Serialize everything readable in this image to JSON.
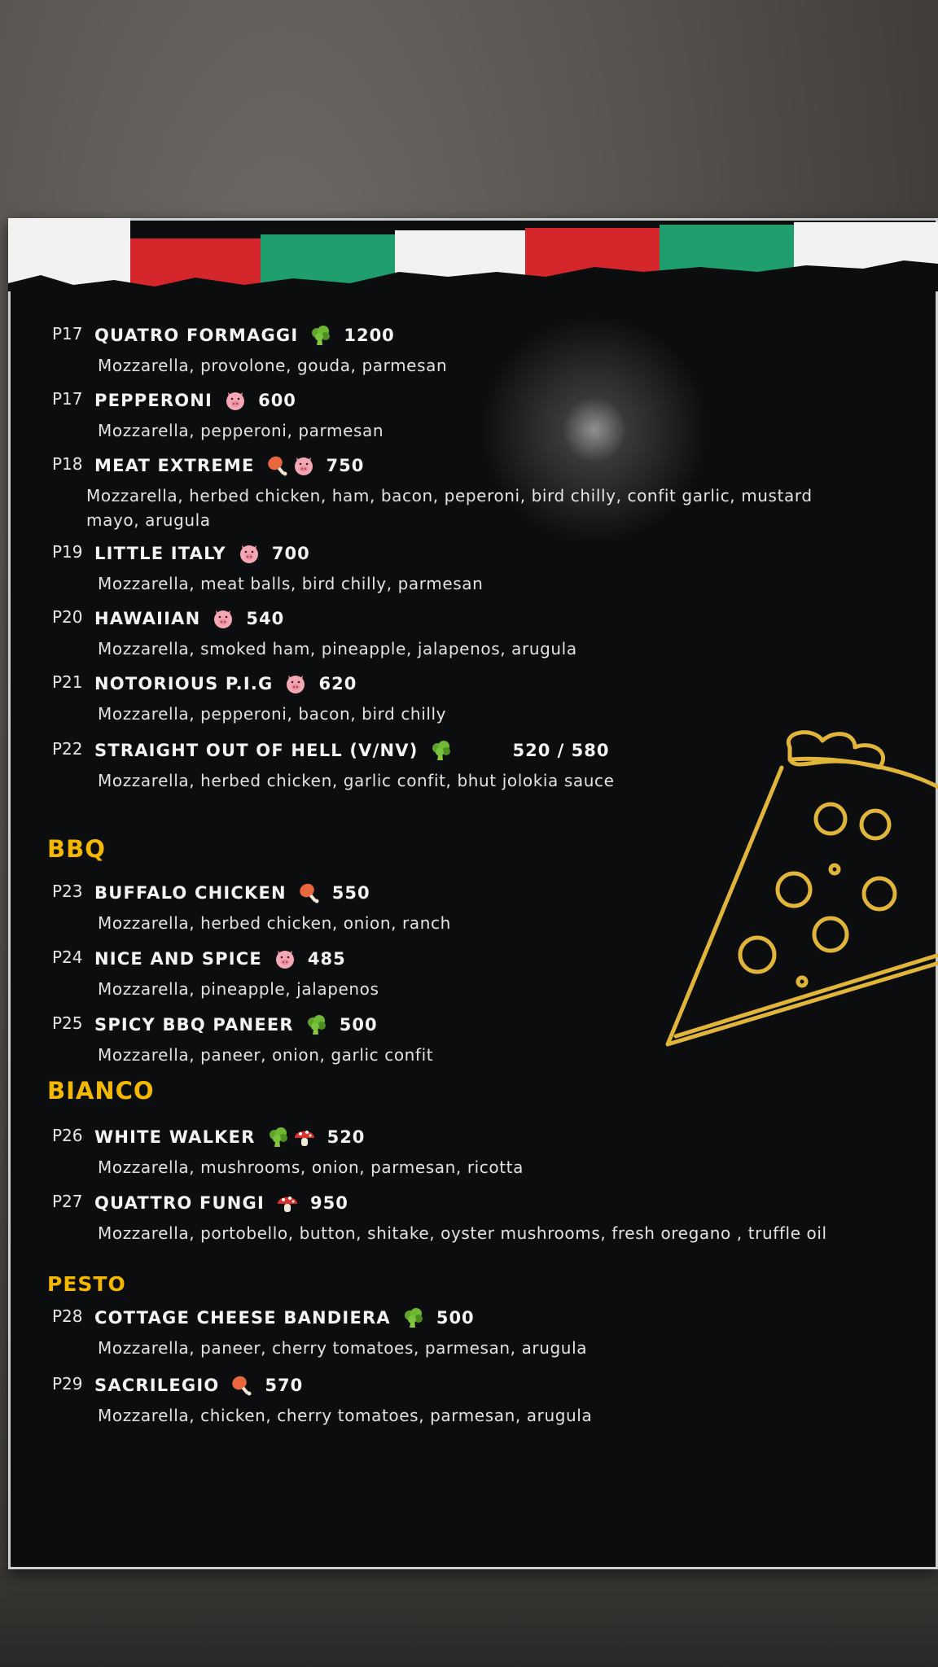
{
  "sections": [
    {
      "heading": "BBQ"
    },
    {
      "heading": "BIANCO"
    },
    {
      "heading": "PESTO"
    }
  ],
  "items": [
    {
      "code": "P17",
      "name": "QUATRO FORMAGGI",
      "price": "1200",
      "icons": [
        "broccoli-icon"
      ],
      "desc": "Mozzarella, provolone, gouda, parmesan"
    },
    {
      "code": "P17",
      "name": "PEPPERONI",
      "price": "600",
      "icons": [
        "pig-icon"
      ],
      "desc": "Mozzarella, pepperoni, parmesan"
    },
    {
      "code": "P18",
      "name": "MEAT EXTREME",
      "price": "750",
      "icons": [
        "drumstick-icon",
        "pig-icon"
      ],
      "desc": "Mozzarella, herbed chicken, ham, bacon, peperoni,  bird chilly, confit garlic, mustard mayo, arugula"
    },
    {
      "code": "P19",
      "name": "LITTLE  ITALY",
      "price": "700",
      "icons": [
        "pig-icon"
      ],
      "desc": "Mozzarella, meat balls, bird chilly, parmesan"
    },
    {
      "code": "P20",
      "name": "HAWAIIAN",
      "price": "540",
      "icons": [
        "pig-icon"
      ],
      "desc": "Mozzarella, smoked ham, pineapple, jalapenos,  arugula"
    },
    {
      "code": "P21",
      "name": "NOTORIOUS P.I.G",
      "price": "620",
      "icons": [
        "pig-icon"
      ],
      "desc": "Mozzarella, pepperoni, bacon, bird chilly"
    },
    {
      "code": "P22",
      "name": "STRAIGHT OUT OF HELL  (V/NV)",
      "price": "520 / 580",
      "icons": [
        "broccoli-icon"
      ],
      "desc": "Mozzarella, herbed chicken, garlic confit, bhut jolokia sauce"
    },
    {
      "code": "P23",
      "name": "BUFFALO CHICKEN",
      "price": "550",
      "icons": [
        "drumstick-icon"
      ],
      "desc": "Mozzarella, herbed chicken, onion, ranch"
    },
    {
      "code": "P24",
      "name": "NICE AND SPICE",
      "price": "485",
      "icons": [
        "pig-icon"
      ],
      "desc": "Mozzarella, pineapple, jalapenos"
    },
    {
      "code": "P25",
      "name": "SPICY BBQ PANEER",
      "price": "500",
      "icons": [
        "broccoli-icon"
      ],
      "desc": "Mozzarella, paneer, onion, garlic confit"
    },
    {
      "code": "P26",
      "name": "WHITE WALKER",
      "price": "520",
      "icons": [
        "broccoli-icon",
        "mushroom-icon"
      ],
      "desc": "Mozzarella, mushrooms, onion, parmesan, ricotta"
    },
    {
      "code": "P27",
      "name": "QUATTRO FUNGI",
      "price": "950",
      "icons": [
        "mushroom-icon"
      ],
      "desc": "Mozzarella, portobello, button, shitake, oyster mushrooms, fresh oregano , truffle oil"
    },
    {
      "code": "P28",
      "name": "COTTAGE CHEESE BANDIERA",
      "price": "500",
      "icons": [
        "broccoli-icon"
      ],
      "desc": "Mozzarella, paneer, cherry tomatoes, parmesan, arugula"
    },
    {
      "code": "P29",
      "name": "SACRILEGIO",
      "price": "570",
      "icons": [
        "drumstick-icon"
      ],
      "desc": "Mozzarella, chicken, cherry tomatoes, parmesan, arugula"
    }
  ],
  "colors": {
    "section_heading": "#f5b800",
    "flag_red": "#d4262b",
    "flag_green": "#1f9e6e",
    "flag_white": "#f2f2f2"
  }
}
